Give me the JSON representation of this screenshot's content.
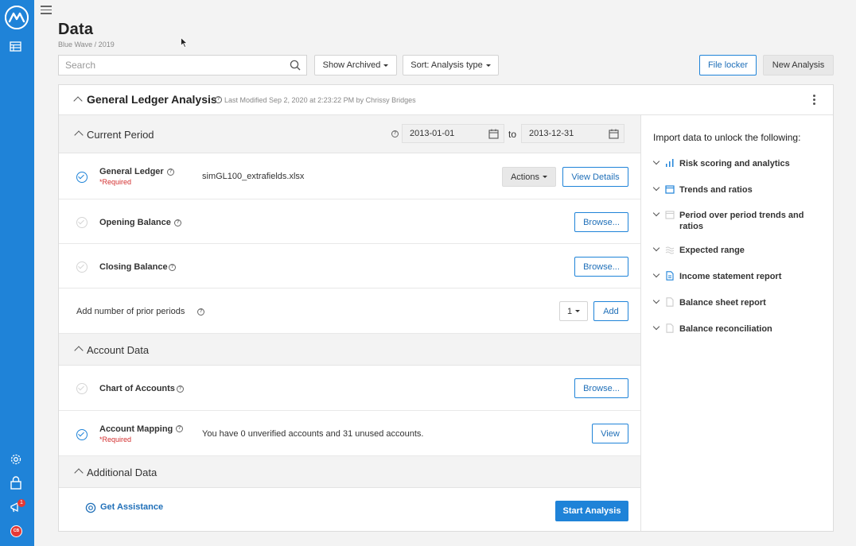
{
  "page": {
    "title": "Data",
    "breadcrumb": "Blue Wave / 2019"
  },
  "toolbar": {
    "search_placeholder": "Search",
    "show_archived": "Show Archived",
    "sort": "Sort: Analysis type",
    "file_locker": "File locker",
    "new_analysis": "New Analysis"
  },
  "analysis": {
    "title": "General Ledger Analysis",
    "modified": "Last Modified Sep 2, 2020 at 2:23:22 PM by Chrissy Bridges"
  },
  "current_period": {
    "title": "Current Period",
    "start_date": "2013-01-01",
    "to_label": "to",
    "end_date": "2013-12-31",
    "rows": [
      {
        "label": "General Ledger",
        "required": "*Required",
        "value": "simGL100_extrafields.xlsx",
        "actions": "Actions",
        "button": "View Details",
        "checked": true
      },
      {
        "label": "Opening Balance",
        "button": "Browse...",
        "checked": false
      },
      {
        "label": "Closing Balance",
        "button": "Browse...",
        "checked": false
      }
    ],
    "prior_periods_label": "Add number of prior periods",
    "prior_periods_value": "1",
    "add_button": "Add"
  },
  "account_data": {
    "title": "Account Data",
    "rows": [
      {
        "label": "Chart of Accounts",
        "button": "Browse...",
        "checked": false
      },
      {
        "label": "Account Mapping",
        "required": "*Required",
        "value": "You have 0 unverified accounts and 31 unused accounts.",
        "button": "View",
        "checked": true
      }
    ]
  },
  "additional_data": {
    "title": "Additional Data",
    "assistance": "Get Assistance",
    "start_button": "Start Analysis"
  },
  "unlock": {
    "title": "Import data to unlock the following:",
    "items": [
      {
        "label": "Risk scoring and analytics",
        "icon": "bar-chart-icon",
        "active": true
      },
      {
        "label": "Trends and ratios",
        "icon": "calendar-icon",
        "active": true
      },
      {
        "label": "Period over period trends and ratios",
        "icon": "calendar-icon",
        "active": false
      },
      {
        "label": "Expected range",
        "icon": "wave-icon",
        "active": false
      },
      {
        "label": "Income statement report",
        "icon": "document-icon",
        "active": true
      },
      {
        "label": "Balance sheet report",
        "icon": "document-icon",
        "active": false
      },
      {
        "label": "Balance reconciliation",
        "icon": "document-icon",
        "active": false
      }
    ]
  },
  "sidebar": {
    "notification_count": "1",
    "avatar_initials": "CB"
  },
  "colors": {
    "primary": "#1f83d8",
    "required": "#d32f2f",
    "notification": "#e53935"
  }
}
